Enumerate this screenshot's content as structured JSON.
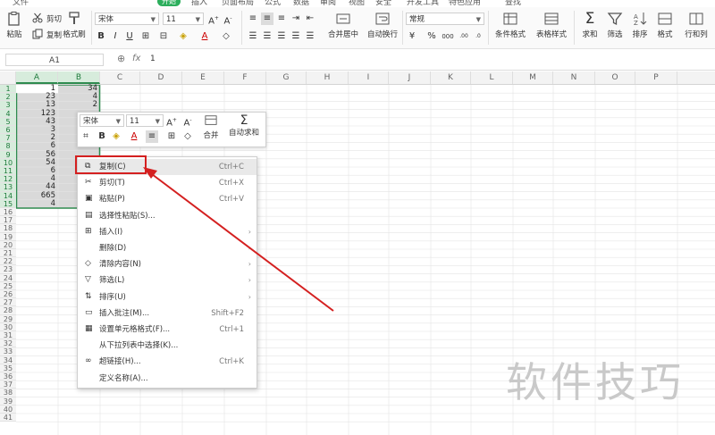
{
  "menubar": {
    "items": [
      "文件",
      "开始",
      "插入",
      "页面布局",
      "公式",
      "数据",
      "审阅",
      "视图",
      "安全",
      "开发工具",
      "特色应用",
      "查找"
    ]
  },
  "ribbon": {
    "paste": "粘贴",
    "cut": "剪切",
    "copy": "复制",
    "format_painter": "格式刷",
    "font_name": "宋体",
    "font_size": "11",
    "bold": "B",
    "italic": "I",
    "underline": "U",
    "merge_center": "合并居中",
    "wrap_text": "自动换行",
    "number_format": "常规",
    "percent": "%",
    "thousands": "000",
    "cond_format": "条件格式",
    "table_style": "表格样式",
    "sum": "求和",
    "filter": "筛选",
    "sort": "排序",
    "format": "格式",
    "rows_cols": "行和列"
  },
  "formula_bar": {
    "name_box": "A1",
    "fx": "fx",
    "value": "1"
  },
  "grid": {
    "columns": [
      "A",
      "B",
      "C",
      "D",
      "E",
      "F",
      "G",
      "H",
      "I",
      "J",
      "K",
      "L",
      "M",
      "N",
      "O",
      "P"
    ],
    "rows": [
      "1",
      "2",
      "3",
      "4",
      "5",
      "6",
      "7",
      "8",
      "9",
      "10",
      "11",
      "12",
      "13",
      "14",
      "15",
      "16",
      "17",
      "18",
      "19",
      "20",
      "21",
      "22",
      "23",
      "24",
      "25",
      "26",
      "27",
      "28",
      "29",
      "30",
      "31",
      "32",
      "33",
      "34",
      "35",
      "36",
      "37",
      "38",
      "39",
      "40",
      "41"
    ],
    "col_a": [
      "1",
      "23",
      "13",
      "123",
      "43",
      "3",
      "2",
      "6",
      "56",
      "54",
      "6",
      "4",
      "44",
      "665",
      "4"
    ],
    "col_b": [
      "34",
      "4",
      "2",
      "",
      "",
      "",
      "5",
      "",
      "",
      "",
      "",
      "",
      "",
      "",
      ""
    ]
  },
  "mini_toolbar": {
    "font_name": "宋体",
    "font_size": "11",
    "grow": "A⁺",
    "shrink": "A⁻",
    "bold": "B",
    "merge": "合并",
    "autosum": "自动求和"
  },
  "context_menu": [
    {
      "label": "复制(C)",
      "shortcut": "Ctrl+C",
      "icon": "copy-icon",
      "submenu": false
    },
    {
      "label": "剪切(T)",
      "shortcut": "Ctrl+X",
      "icon": "scissors-icon",
      "submenu": false
    },
    {
      "label": "粘贴(P)",
      "shortcut": "Ctrl+V",
      "icon": "paste-icon",
      "submenu": false
    },
    {
      "label": "选择性粘贴(S)...",
      "shortcut": "",
      "icon": "paste-special-icon",
      "submenu": false
    },
    {
      "label": "插入(I)",
      "shortcut": "",
      "icon": "insert-icon",
      "submenu": true
    },
    {
      "label": "删除(D)",
      "shortcut": "",
      "icon": "",
      "submenu": true
    },
    {
      "label": "清除内容(N)",
      "shortcut": "",
      "icon": "eraser-icon",
      "submenu": true
    },
    {
      "label": "筛选(L)",
      "shortcut": "",
      "icon": "filter-icon",
      "submenu": true
    },
    {
      "label": "排序(U)",
      "shortcut": "",
      "icon": "sort-icon",
      "submenu": true
    },
    {
      "label": "插入批注(M)...",
      "shortcut": "Shift+F2",
      "icon": "comment-icon",
      "submenu": false
    },
    {
      "label": "设置单元格格式(F)...",
      "shortcut": "Ctrl+1",
      "icon": "format-cells-icon",
      "submenu": false
    },
    {
      "label": "从下拉列表中选择(K)...",
      "shortcut": "",
      "icon": "",
      "submenu": false
    },
    {
      "label": "超链接(H)...",
      "shortcut": "Ctrl+K",
      "icon": "link-icon",
      "submenu": false
    },
    {
      "label": "定义名称(A)...",
      "shortcut": "",
      "icon": "",
      "submenu": false
    }
  ],
  "watermark": "软件技巧",
  "colors": {
    "selection_green": "#2e8b4f",
    "selection_fill": "#d9d9d9",
    "annotation_red": "#d42020"
  }
}
